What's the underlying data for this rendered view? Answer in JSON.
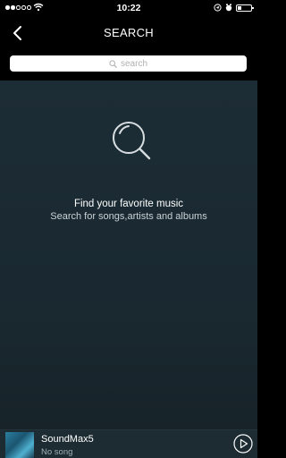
{
  "status_bar": {
    "time": "10:22",
    "signal_bars_filled": 2,
    "signal_bars_total": 5
  },
  "nav": {
    "title": "SEARCH"
  },
  "search": {
    "placeholder": "search"
  },
  "empty_state": {
    "title": "Find your favorite music",
    "subtitle": "Search for songs,artists and albums"
  },
  "player": {
    "title": "SoundMax5",
    "subtitle": "No song"
  },
  "icons": {
    "back": "chevron-left-icon",
    "search": "search-icon",
    "play": "play-icon",
    "wifi": "wifi-icon",
    "battery": "battery-icon"
  },
  "colors": {
    "background": "#1b2a31",
    "bar": "#000000",
    "text": "#ffffff",
    "muted_text": "#c9d2d6"
  }
}
